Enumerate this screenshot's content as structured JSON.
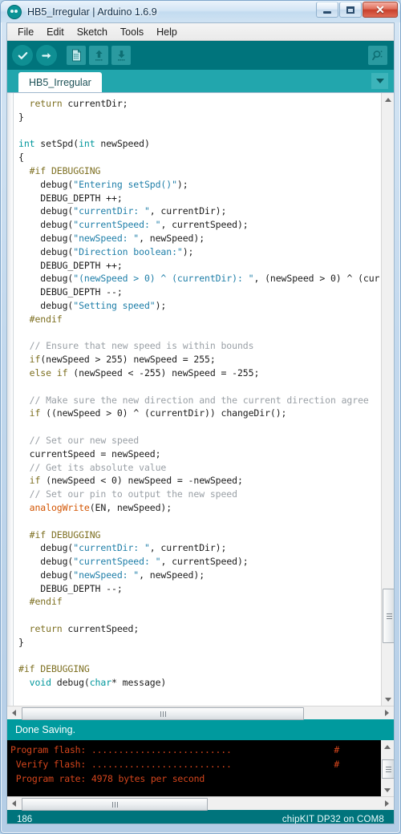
{
  "window": {
    "title": "HB5_Irregular | Arduino 1.6.9",
    "app_icon": "arduino-infinity-icon",
    "controls": {
      "minimize": "minimize-icon",
      "maximize": "maximize-icon",
      "close": "✕"
    }
  },
  "menubar": {
    "items": [
      {
        "label": "File"
      },
      {
        "label": "Edit"
      },
      {
        "label": "Sketch"
      },
      {
        "label": "Tools"
      },
      {
        "label": "Help"
      }
    ]
  },
  "toolbar": {
    "buttons": [
      {
        "name": "verify-button",
        "icon": "check-icon",
        "tooltip": "Verify"
      },
      {
        "name": "upload-button",
        "icon": "right-arrow-icon",
        "tooltip": "Upload"
      },
      {
        "name": "new-button",
        "icon": "new-file-icon",
        "tooltip": "New"
      },
      {
        "name": "open-button",
        "icon": "up-arrow-icon",
        "tooltip": "Open"
      },
      {
        "name": "save-button",
        "icon": "down-arrow-icon",
        "tooltip": "Save"
      }
    ],
    "serial_monitor": {
      "icon": "magnifier-icon",
      "tooltip": "Serial Monitor"
    }
  },
  "tabs": {
    "active": "HB5_Irregular",
    "menu_icon": "chevron-down-icon"
  },
  "editor": {
    "code": "  return currentDir;\n}\n\nint setSpd(int newSpeed)\n{\n  #if DEBUGGING\n    debug(\"Entering setSpd()\");\n    DEBUG_DEPTH ++;\n    debug(\"currentDir: \", currentDir);\n    debug(\"currentSpeed: \", currentSpeed);\n    debug(\"newSpeed: \", newSpeed);\n    debug(\"Direction boolean:\");\n    DEBUG_DEPTH ++;\n    debug(\"(newSpeed > 0) ^ (currentDir): \", (newSpeed > 0) ^ (cur\n    DEBUG_DEPTH --;\n    debug(\"Setting speed\");\n  #endif\n\n  // Ensure that new speed is within bounds\n  if(newSpeed > 255) newSpeed = 255;\n  else if (newSpeed < -255) newSpeed = -255;\n\n  // Make sure the new direction and the current direction agree\n  if ((newSpeed > 0) ^ (currentDir)) changeDir();\n\n  // Set our new speed\n  currentSpeed = newSpeed;\n  // Get its absolute value\n  if (newSpeed < 0) newSpeed = -newSpeed;\n  // Set our pin to output the new speed\n  analogWrite(EN, newSpeed);\n\n  #if DEBUGGING\n    debug(\"currentDir: \", currentDir);\n    debug(\"currentSpeed: \", currentSpeed);\n    debug(\"newSpeed: \", newSpeed);\n    DEBUG_DEPTH --;\n  #endif\n\n  return currentSpeed;\n}\n\n#if DEBUGGING\n  void debug(char* message)",
    "vertical_scrollbar": {
      "up_icon": "caret-up-icon",
      "down_icon": "caret-down-icon"
    },
    "horizontal_scrollbar": {
      "left_icon": "caret-left-icon",
      "right_icon": "caret-right-icon"
    }
  },
  "status_message": {
    "text": "Done Saving."
  },
  "console": {
    "lines": [
      "Program flash: ..........................                   #",
      " Verify flash: ..........................                   #",
      " Program rate: 4978 bytes per second"
    ],
    "text_color": "#d4451c",
    "background": "#000000",
    "horizontal_scrollbar": {
      "left_icon": "caret-left-icon",
      "right_icon": "caret-right-icon"
    },
    "vertical_scrollbar": {
      "up_icon": "caret-up-icon",
      "down_icon": "caret-down-icon"
    }
  },
  "statusbar": {
    "line_number": "186",
    "board": "chipKIT DP32 on COM8"
  },
  "theme": {
    "toolbar_bg": "#00747c",
    "tabbar_bg": "#22a6ad",
    "status_bg": "#009a9e",
    "statusbar_bg": "#00747c",
    "keyword_color": "#00979c",
    "preprocessor_color": "#7e7022",
    "string_color": "#1e7ea8",
    "comment_color": "#9aa0a6",
    "function_color": "#d35400"
  }
}
